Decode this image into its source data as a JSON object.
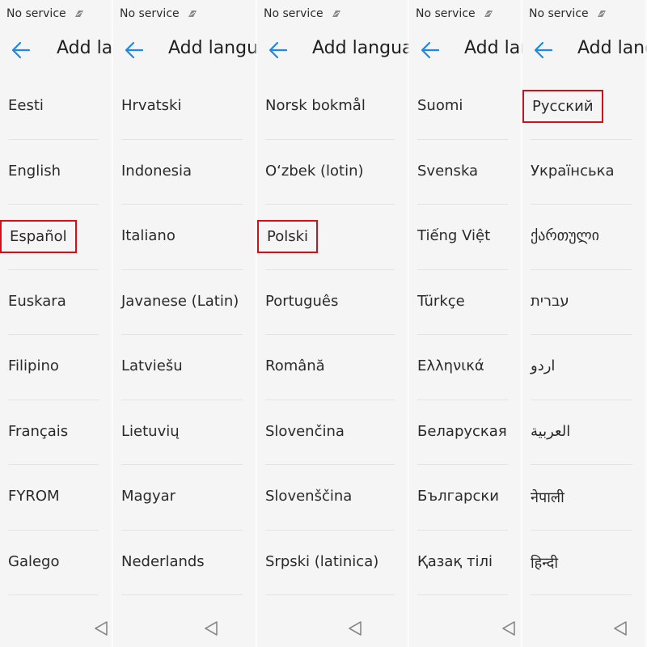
{
  "panels": [
    {
      "status": "No service",
      "title": "Add lar",
      "items": [
        {
          "label": "Eesti"
        },
        {
          "label": "English"
        },
        {
          "label": "Español",
          "highlight": true
        },
        {
          "label": "Euskara"
        },
        {
          "label": "Filipino"
        },
        {
          "label": "Français"
        },
        {
          "label": "FYROM"
        },
        {
          "label": "Galego"
        }
      ]
    },
    {
      "status": "No service",
      "title": "Add langua",
      "items": [
        {
          "label": "Hrvatski"
        },
        {
          "label": "Indonesia"
        },
        {
          "label": "Italiano"
        },
        {
          "label": "Javanese (Latin)"
        },
        {
          "label": "Latviešu"
        },
        {
          "label": "Lietuvių"
        },
        {
          "label": "Magyar"
        },
        {
          "label": "Nederlands"
        }
      ]
    },
    {
      "status": "No service",
      "title": "Add languac",
      "items": [
        {
          "label": "Norsk bokmål"
        },
        {
          "label": "O‘zbek (lotin)"
        },
        {
          "label": "Polski",
          "highlight": true
        },
        {
          "label": "Português"
        },
        {
          "label": "Română"
        },
        {
          "label": "Slovenčina"
        },
        {
          "label": "Slovenščina"
        },
        {
          "label": "Srpski (latinica)"
        }
      ]
    },
    {
      "status": "No service",
      "title": "Add lar",
      "items": [
        {
          "label": "Suomi"
        },
        {
          "label": "Svenska"
        },
        {
          "label": "Tiếng Việt"
        },
        {
          "label": "Türkçe"
        },
        {
          "label": "Ελληνικά"
        },
        {
          "label": "Беларуская"
        },
        {
          "label": "Български"
        },
        {
          "label": "Қазақ тілі"
        }
      ]
    },
    {
      "status": "No service",
      "title": "Add lang",
      "items": [
        {
          "label": "Русский",
          "highlight": true
        },
        {
          "label": "Українська"
        },
        {
          "label": "ქართული"
        },
        {
          "label": "עברית"
        },
        {
          "label": "اردو"
        },
        {
          "label": "العربية"
        },
        {
          "label": "नेपाली"
        },
        {
          "label": "हिन्दी"
        }
      ]
    }
  ],
  "colors": {
    "accent": "#1e88e5",
    "highlight_border": "#d0101b",
    "text": "#2a2a2a"
  },
  "icons": {
    "back": "arrow-left-icon",
    "nav_back": "triangle-back-icon",
    "sim": "no-sim-icon"
  }
}
